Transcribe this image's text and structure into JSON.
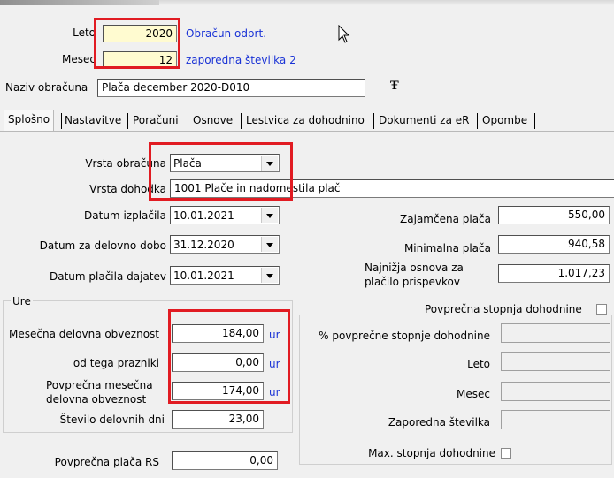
{
  "header": {
    "leto_label": "Leto",
    "leto_value": "2020",
    "status_text": "Obračun odprt.",
    "mesec_label": "Mesec",
    "mesec_value": "12",
    "zaporedna_text": "zaporedna številka 2",
    "naziv_label": "Naziv obračuna",
    "naziv_value": "Plača december 2020-D010"
  },
  "tabs": [
    {
      "label": "Splošno",
      "selected": true
    },
    {
      "label": "Nastavitve"
    },
    {
      "label": "Poračuni"
    },
    {
      "label": "Osnove"
    },
    {
      "label": "Lestvica za dohodnino"
    },
    {
      "label": "Dokumenti za eR"
    },
    {
      "label": "Opombe"
    }
  ],
  "general": {
    "vrsta_obracuna_label": "Vrsta obračuna",
    "vrsta_obracuna_value": "Plača",
    "vrsta_dohodka_label": "Vrsta dohodka",
    "vrsta_dohodka_value": "1001  Plače in nadomestila plač",
    "datum_izplacila_label": "Datum izplačila",
    "datum_izplacila_value": "10.01.2021",
    "datum_delovno_dobo_label": "Datum za delovno dobo",
    "datum_delovno_dobo_value": "31.12.2020",
    "datum_placila_label": "Datum plačila dajatev",
    "datum_placila_value": "10.01.2021",
    "zajamcena_label": "Zajamčena plača",
    "zajamcena_value": "550,00",
    "minimalna_label": "Minimalna plača",
    "minimalna_value": "940,58",
    "najnizja_label_1": "Najnižja osnova za",
    "najnizja_label_2": "plačilo prispevkov",
    "najnizja_value": "1.017,23"
  },
  "ure": {
    "legend": "Ure",
    "mesecna_label": "Mesečna delovna obveznost",
    "mesecna_value": "184,00",
    "prazniki_label": "od tega prazniki",
    "prazniki_value": "0,00",
    "povprecna_label_1": "Povprečna mesečna",
    "povprecna_label_2": "delovna obveznost",
    "povprecna_value": "174,00",
    "unit": "ur",
    "stevilo_label": "Število delovnih dni",
    "stevilo_value": "23,00"
  },
  "dohodnina": {
    "checkbox_label": "Povprečna stopnja dohodnine",
    "percent_label": "% povprečne stopnje dohodnine",
    "leto_label": "Leto",
    "mesec_label": "Mesec",
    "zaporedna_label": "Zaporedna številka",
    "max_label": "Max. stopnja dohodnine"
  },
  "footer": {
    "povprecna_placa_label": "Povprečna plača RS",
    "povprecna_placa_value": "0,00"
  }
}
